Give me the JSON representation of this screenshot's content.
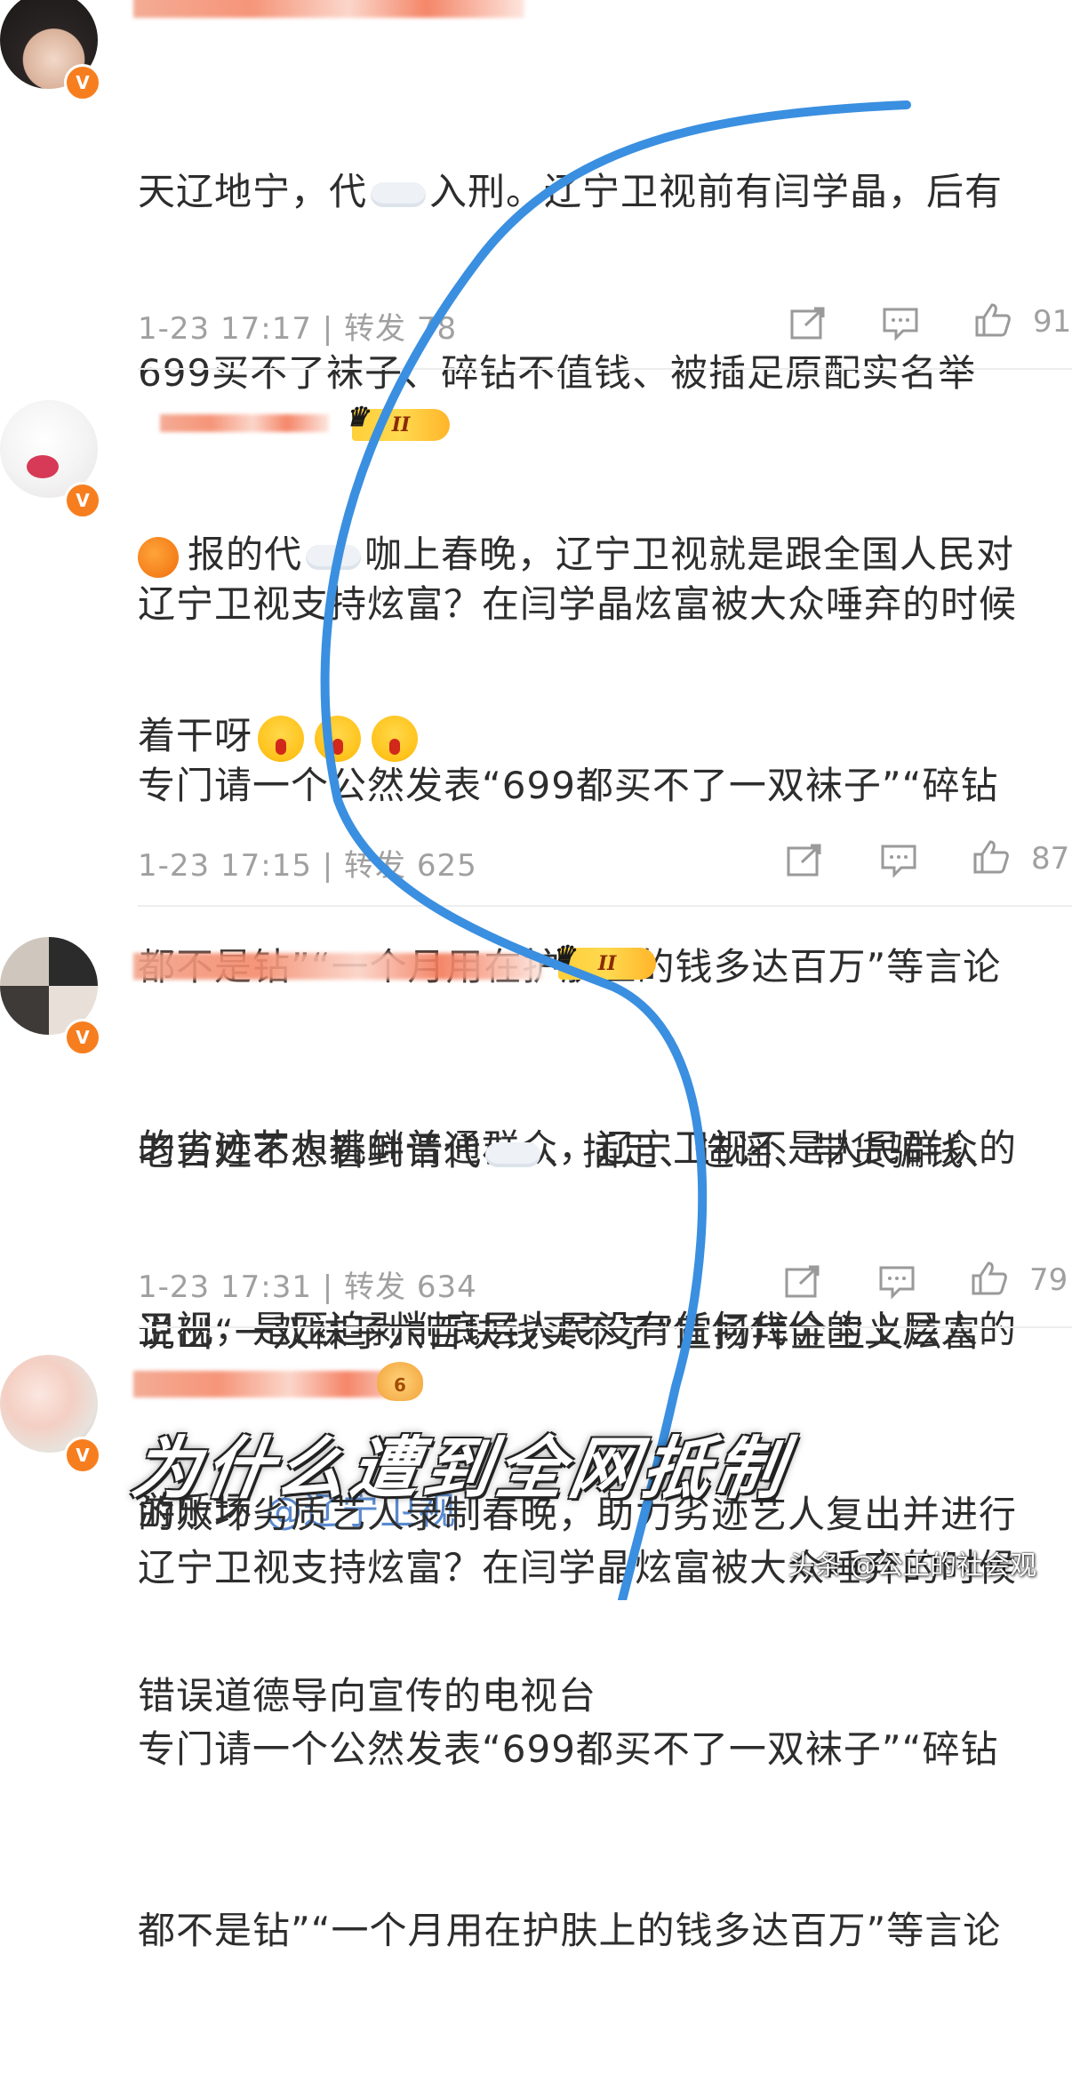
{
  "comments": [
    {
      "lines": [
        "天辽地宁，代",
        "入刑。辽宁卫视前有闫学晶，后有",
        "699买不了袜子、碎钻不值钱、被插足原配实名举",
        "报的代",
        "咖上春晚，辽宁卫视就是跟全国人民对",
        "着干呀"
      ],
      "time": "1-23 17:17",
      "repost": "转发 78",
      "likes": "91"
    },
    {
      "lines": [
        "辽宁卫视支持炫富？在闫学晶炫富被大众唾弃的时候",
        "专门请一个公然发表“699都买不了一双袜子”“碎钻",
        "都不是钻”“一个月用在护肤上的钱多达百万”等言论",
        "的劣迹艺人挑衅普通群众，辽宁卫视不是人民群众的",
        "卫视，是压迫剥削底层人民没有任何代价的上层人的",
        "游乐场"
      ],
      "mention": "@辽宁卫视",
      "time": "1-23 17:15",
      "repost": "转发 625",
      "likes": "87"
    },
    {
      "lines": [
        "老百姓不想看到请代",
        "、插足、造谣、带货骗钱、",
        "说出“一双袜子六百块钱买不了”宣扬拜金主义炫富",
        "的败坏劣质艺人录制春晚，助力劣迹艺人复出并进行",
        "错误道德导向宣传的电视台"
      ],
      "time": "1-23 17:31",
      "repost": "转发 634",
      "likes": "79"
    },
    {
      "lines": [
        "辽宁卫视支持炫富？在闫学晶炫富被大众唾弃的时候",
        "专门请一个公然发表“699都买不了一双袜子”“碎钻",
        "都不是钻”“一个月用在护肤上的钱多达百万”等言论"
      ]
    }
  ],
  "badges": {
    "verified": "V",
    "crown_level": "II",
    "level_6": "6"
  },
  "overlay_title": "为什么遭到全网抵制",
  "watermark": "头条 @公正的社会观",
  "colors": {
    "curve": "#3a8fe0",
    "verified": "#f77e1f",
    "crown": "#ffcf3a",
    "mention": "#5a8ad0"
  },
  "icons": [
    "share-icon",
    "comment-icon",
    "like-icon"
  ]
}
